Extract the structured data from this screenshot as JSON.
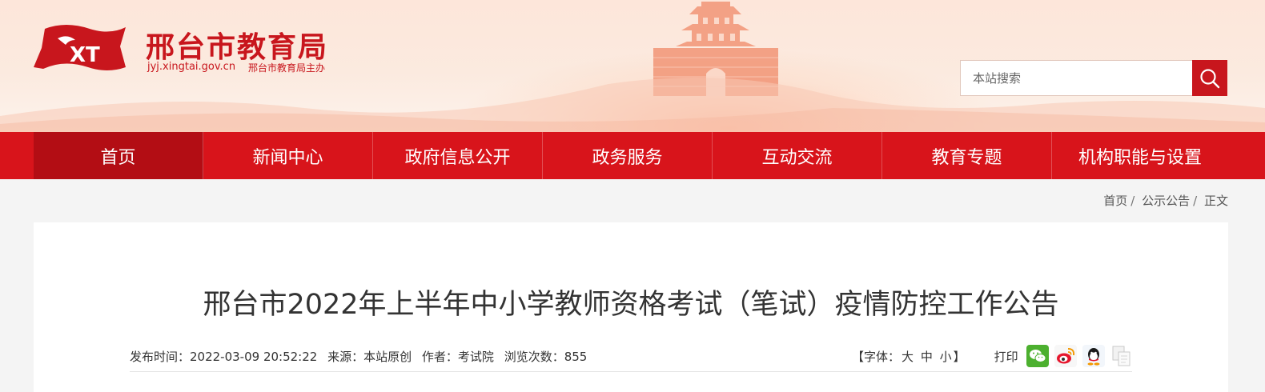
{
  "site": {
    "title": "邢台市教育局",
    "domain": "jyj.xingtai.gov.cn",
    "host": "邢台市教育局主办",
    "logo_mark": "XT"
  },
  "search": {
    "placeholder": "本站搜索"
  },
  "nav": {
    "items": [
      {
        "label": "首页"
      },
      {
        "label": "新闻中心"
      },
      {
        "label": "政府信息公开"
      },
      {
        "label": "政务服务"
      },
      {
        "label": "互动交流"
      },
      {
        "label": "教育专题"
      },
      {
        "label": "机构职能与设置"
      }
    ]
  },
  "breadcrumb": {
    "home": "首页",
    "section": "公示公告",
    "current": "正文"
  },
  "article": {
    "title": "邢台市2022年上半年中小学教师资格考试（笔试）疫情防控工作公告",
    "publish_time": "发布时间：2022-03-09 20:52:22",
    "source": "来源：本站原创",
    "author": "作者：考试院",
    "views": "浏览次数：855"
  },
  "tools": {
    "font_label": "【字体：",
    "font_large": "大",
    "font_medium": "中",
    "font_small": "小",
    "font_close": "】",
    "print": "打印",
    "share": [
      "wechat-icon",
      "weibo-icon",
      "qq-icon",
      "copy-icon"
    ]
  },
  "colors": {
    "brand_red": "#d8141b",
    "active_red": "#b30d14"
  }
}
